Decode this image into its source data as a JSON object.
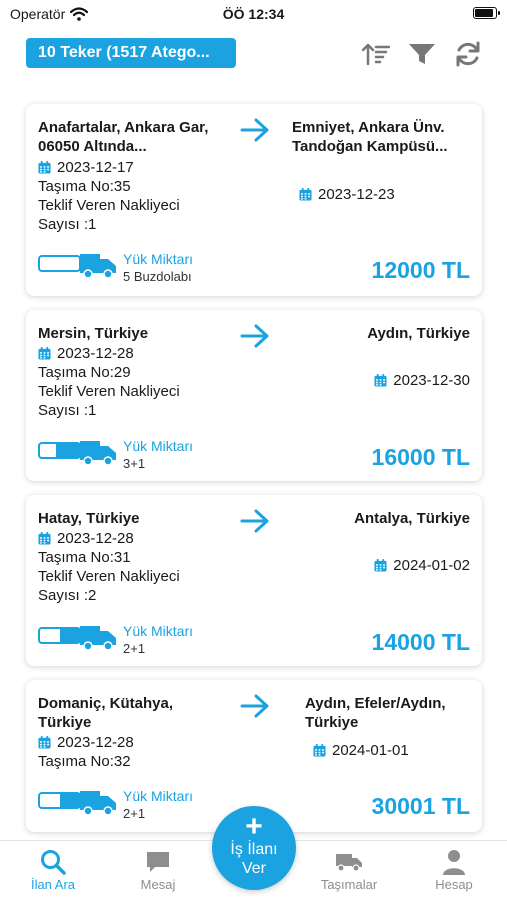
{
  "status_bar": {
    "carrier": "Operatör",
    "time": "ÖÖ 12:34"
  },
  "header": {
    "vehicle_select": "10 Teker (1517 Atego..."
  },
  "listings": [
    {
      "from": "Anafartalar, Ankara Gar, 06050 Altında...",
      "from_date": "2023-12-17",
      "transport_no": "Taşıma No:35",
      "offer_count": "Teklif Veren Nakliyeci Sayısı :1",
      "to": "Emniyet, Ankara Ünv. Tandoğan Kampüsü...",
      "to_date": "2023-12-23",
      "load_label": "Yük Miktarı",
      "load_value": "5 Buzdolabı",
      "price": "12000 TL"
    },
    {
      "from": "Mersin, Türkiye",
      "from_date": "2023-12-28",
      "transport_no": "Taşıma No:29",
      "offer_count": "Teklif Veren Nakliyeci Sayısı :1",
      "to": "Aydın, Türkiye",
      "to_date": "2023-12-30",
      "load_label": "Yük Miktarı",
      "load_value": "3+1",
      "price": "16000 TL"
    },
    {
      "from": "Hatay, Türkiye",
      "from_date": "2023-12-28",
      "transport_no": "Taşıma No:31",
      "offer_count": "Teklif Veren Nakliyeci Sayısı :2",
      "to": "Antalya, Türkiye",
      "to_date": "2024-01-02",
      "load_label": "Yük Miktarı",
      "load_value": "2+1",
      "price": "14000 TL"
    },
    {
      "from": "Domaniç, Kütahya, Türkiye",
      "from_date": "2023-12-28",
      "transport_no": "Taşıma No:32",
      "to": "Aydın, Efeler/Aydın, Türkiye",
      "to_date": "2024-01-01",
      "load_label": "Yük Miktarı",
      "load_value": "2+1",
      "price": "30001 TL"
    }
  ],
  "fab": {
    "line1": "İş İlanı",
    "line2": "Ver"
  },
  "tabs": {
    "search": "İlan Ara",
    "messages": "Mesaj",
    "shipments": "Taşımalar",
    "account": "Hesap"
  },
  "colors": {
    "accent": "#1aa3e0",
    "inactive_tab": "#8e8e8e"
  },
  "icons": [
    "wifi-icon",
    "battery-icon",
    "sort-icon",
    "filter-icon",
    "refresh-icon",
    "arrow-right-icon",
    "calendar-icon",
    "truck-icon",
    "plus-icon",
    "search-icon",
    "chat-icon",
    "user-icon"
  ]
}
